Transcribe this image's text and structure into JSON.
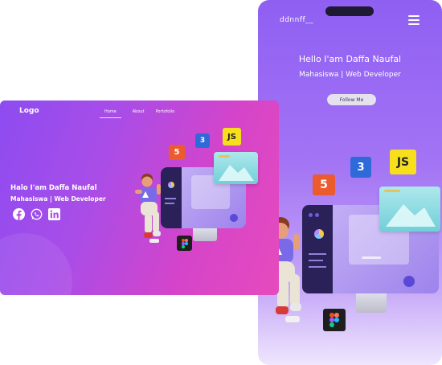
{
  "mobile": {
    "logo": "ddnnff__",
    "title": "Hello I'am Daffa Naufal",
    "subtitle": "Mahasiswa | Web Developer",
    "follow_label": "Follow Me",
    "menu_icon": "hamburger-icon"
  },
  "desktop": {
    "logo": "Logo",
    "nav": [
      {
        "label": "Home",
        "active": true
      },
      {
        "label": "About",
        "active": false
      },
      {
        "label": "Portofolio",
        "active": false
      }
    ],
    "title": "Halo I'am Daffa Naufal",
    "subtitle": "Mahasiswa | Web Developer",
    "social_icons": [
      "facebook-icon",
      "whatsapp-icon",
      "linkedin-icon"
    ]
  },
  "badges": {
    "html": "5",
    "css": "3",
    "js": "JS"
  },
  "colors": {
    "mobile_bg_top": "#8f5ff3",
    "desktop_bg_left": "#8d4cf0",
    "desktop_bg_right": "#e64bbd",
    "html_badge": "#ec5b2d",
    "css_badge": "#2f6ad9",
    "js_badge": "#f7df1e"
  }
}
